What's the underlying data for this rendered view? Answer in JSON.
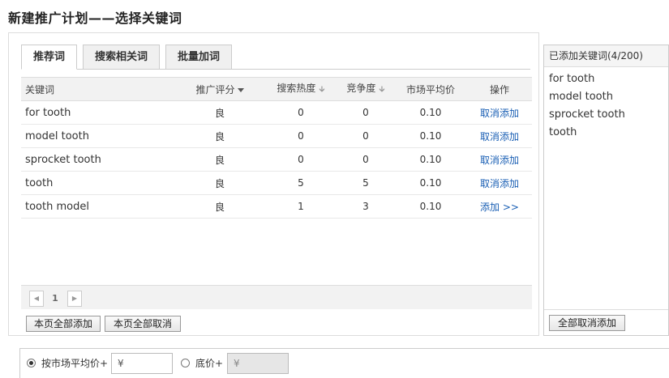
{
  "page": {
    "title": "新建推广计划——选择关键词"
  },
  "tabs": [
    {
      "label": "推荐词",
      "active": true
    },
    {
      "label": "搜索相关词",
      "active": false
    },
    {
      "label": "批量加词",
      "active": false
    }
  ],
  "table": {
    "headers": {
      "keyword": "关键词",
      "score": "推广评分",
      "heat": "搜索热度",
      "competition": "竞争度",
      "avg_price": "市场平均价",
      "action": "操作"
    },
    "rows": [
      {
        "keyword": "for tooth",
        "score": "良",
        "heat": "0",
        "competition": "0",
        "avg_price": "0.10",
        "action": "取消添加"
      },
      {
        "keyword": "model tooth",
        "score": "良",
        "heat": "0",
        "competition": "0",
        "avg_price": "0.10",
        "action": "取消添加"
      },
      {
        "keyword": "sprocket tooth",
        "score": "良",
        "heat": "0",
        "competition": "0",
        "avg_price": "0.10",
        "action": "取消添加"
      },
      {
        "keyword": "tooth",
        "score": "良",
        "heat": "5",
        "competition": "5",
        "avg_price": "0.10",
        "action": "取消添加"
      },
      {
        "keyword": "tooth model",
        "score": "良",
        "heat": "1",
        "competition": "3",
        "avg_price": "0.10",
        "action": "添加 >>"
      }
    ]
  },
  "pager": {
    "current": "1"
  },
  "bulk_buttons": {
    "add_all": "本页全部添加",
    "cancel_all": "本页全部取消"
  },
  "added_panel": {
    "title": "已添加关键词(4/200)",
    "items": [
      "for tooth",
      "model tooth",
      "sprocket tooth",
      "tooth"
    ],
    "cancel_all_label": "全部取消添加"
  },
  "price_options": {
    "market_label": "按市场平均价+",
    "market_value": "¥",
    "base_label": "底价+",
    "base_value": "¥",
    "selected": "market"
  }
}
